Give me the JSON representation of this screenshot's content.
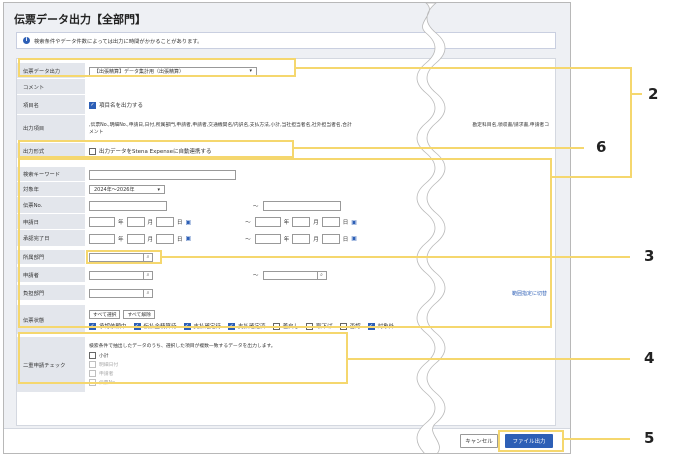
{
  "title": "伝票データ出力【全部門】",
  "notice": "検索条件やデータ件数によっては出力に時間がかかることがあります。",
  "rows": {
    "output_type": {
      "label": "伝票データ出力",
      "value": "【出張精算】データ集計用（出張精算）"
    },
    "comment": {
      "label": "コメント"
    },
    "item_name": {
      "label": "項目名",
      "option": "項目名を出力する"
    },
    "output_items": {
      "label": "出力項目",
      "value_left": ",伝票No.,明細No.,申請日,日付,所属部門,申請者,申請者,交通機関名/内訳名,支払方法,小計,当社担当者名,社外担当者名,合計",
      "value_right": "勘定科目名,領収書/請求書,申請者コ",
      "value_wrap": "メント"
    },
    "output_format": {
      "label": "出力形式",
      "option": "出力データをStena Expenseに自動連携する"
    },
    "keyword": {
      "label": "検索キーワード"
    },
    "target_year": {
      "label": "対象年",
      "value": "2024年～2026年"
    },
    "slip_no": {
      "label": "伝票No.",
      "tilde": "～"
    },
    "apply_date": {
      "label": "申請日",
      "year": "年",
      "month": "月",
      "day": "日",
      "tilde": "～"
    },
    "approve_date": {
      "label": "承認完了日",
      "year": "年",
      "month": "月",
      "day": "日",
      "tilde": "～"
    },
    "department": {
      "label": "所属部門",
      "right_link": ""
    },
    "applicant": {
      "label": "申請者",
      "tilde": "～"
    },
    "burden_dept": {
      "label": "負担部門",
      "link": "範囲指定に切替"
    },
    "slip_status": {
      "label": "伝票状態",
      "select_all": "すべて選択",
      "clear_all": "すべて解除",
      "options": [
        {
          "label": "承認依頼中",
          "checked": true
        },
        {
          "label": "仮払金精算待",
          "checked": true
        },
        {
          "label": "支払確定待",
          "checked": true
        },
        {
          "label": "支払確定済",
          "checked": true
        },
        {
          "label": "差戻し",
          "checked": false
        },
        {
          "label": "取下げ",
          "checked": false
        },
        {
          "label": "否認",
          "checked": false
        },
        {
          "label": "対象外",
          "checked": true
        }
      ]
    },
    "double_check": {
      "label": "二重申請チェック",
      "description": "検索条件で抽出したデータのうち、選択した項目が複数一致するデータを出力します。",
      "options": [
        {
          "label": "小計",
          "enabled": true
        },
        {
          "label": "明細日付",
          "enabled": false
        },
        {
          "label": "申請者",
          "enabled": false
        },
        {
          "label": "伝票No.",
          "enabled": false
        }
      ]
    }
  },
  "footer": {
    "cancel": "キャンセル",
    "export": "ファイル出力"
  },
  "callouts": [
    "2",
    "6",
    "3",
    "4",
    "5"
  ],
  "colors": {
    "accent": "#2d5fb6",
    "highlight": "#f5d76e"
  },
  "icons": {
    "info": "info-icon",
    "search": "search-icon",
    "calendar": "calendar-icon",
    "dropdown": "chevron-down-icon"
  }
}
